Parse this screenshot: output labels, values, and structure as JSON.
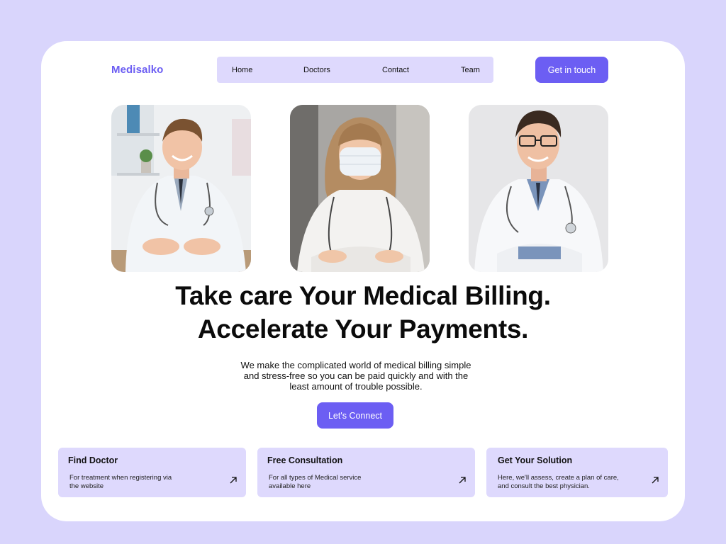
{
  "brand": {
    "name": "Medisalko",
    "accent": "#6c5ef3",
    "soft": "#ded9fd",
    "background": "#d9d5fc"
  },
  "nav": {
    "items": [
      "Home",
      "Doctors",
      "Contact",
      "Team"
    ],
    "cta_label": "Get in touch"
  },
  "photos": [
    {
      "icon": "doctor-male-desk-photo"
    },
    {
      "icon": "doctor-female-mask-photo"
    },
    {
      "icon": "doctor-male-glasses-photo"
    }
  ],
  "hero": {
    "headline_line1": "Take care Your Medical Billing.",
    "headline_line2": "Accelerate Your Payments.",
    "sub_line1": "We make the complicated world of medical billing simple",
    "sub_line2": "and stress-free so you can be paid quickly and with the",
    "sub_line3": "least amount of trouble possible.",
    "cta_label": "Let's Connect"
  },
  "features": [
    {
      "title": "Find Doctor",
      "desc_line1": "For  treatment when registering via",
      "desc_line2": "the website",
      "icon": "arrow-up-right-icon"
    },
    {
      "title": "Free Consultation",
      "desc_line1": "For all types of Medical service",
      "desc_line2": "available here",
      "icon": "arrow-up-right-icon"
    },
    {
      "title": "Get Your Solution",
      "desc_line1": "Here, we'll assess, create a plan of care,",
      "desc_line2": "and consult the best physician.",
      "icon": "arrow-up-right-icon"
    }
  ]
}
